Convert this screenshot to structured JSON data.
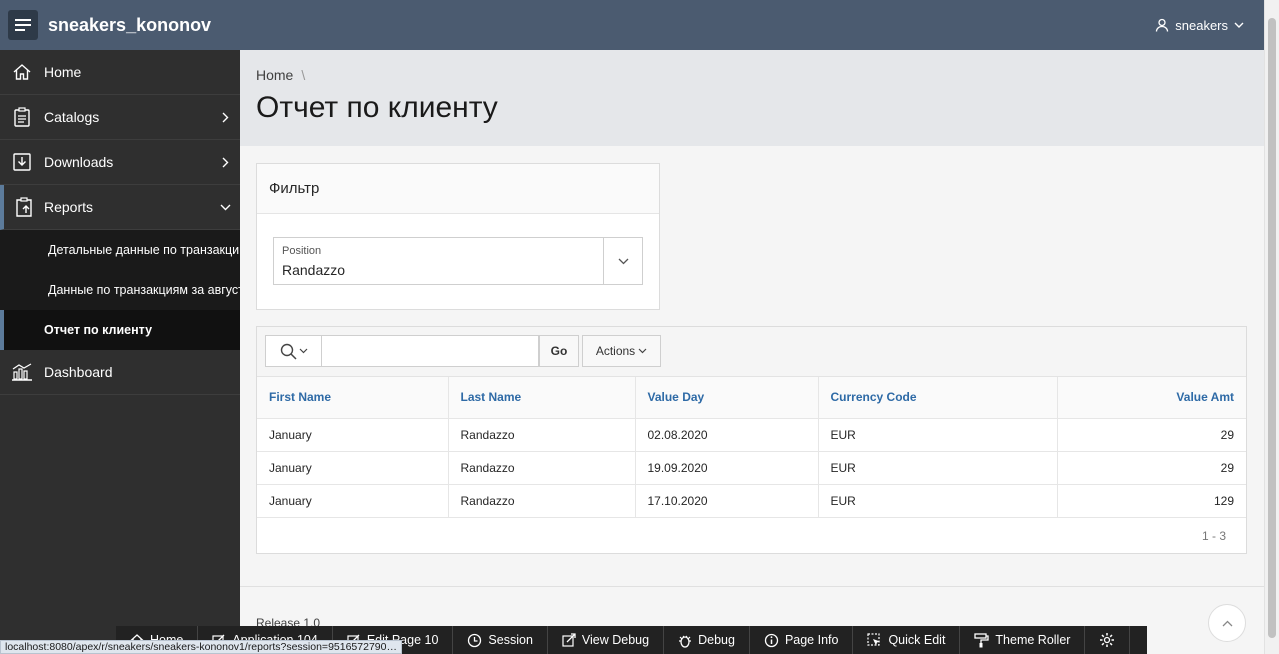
{
  "header": {
    "app_title": "sneakers_kononov",
    "user": "sneakers"
  },
  "sidebar": {
    "items": [
      {
        "label": "Home"
      },
      {
        "label": "Catalogs"
      },
      {
        "label": "Downloads"
      },
      {
        "label": "Reports"
      },
      {
        "label": "Dashboard"
      }
    ],
    "reports_sub": [
      {
        "label": "Детальные данные по транзакци…"
      },
      {
        "label": "Данные по транзакциям за август"
      },
      {
        "label": "Отчет по клиенту"
      }
    ]
  },
  "breadcrumb": {
    "home": "Home",
    "separator": "\\"
  },
  "page": {
    "title": "Отчет по клиенту"
  },
  "filter": {
    "title": "Фильтр",
    "position_label": "Position",
    "position_value": "Randazzo"
  },
  "report": {
    "search_placeholder": "",
    "go_label": "Go",
    "actions_label": "Actions",
    "columns": [
      "First Name",
      "Last Name",
      "Value Day",
      "Currency Code",
      "Value Amt"
    ],
    "rows": [
      [
        "January",
        "Randazzo",
        "02.08.2020",
        "EUR",
        "29"
      ],
      [
        "January",
        "Randazzo",
        "19.09.2020",
        "EUR",
        "29"
      ],
      [
        "January",
        "Randazzo",
        "17.10.2020",
        "EUR",
        "129"
      ]
    ],
    "pagination": "1 - 3"
  },
  "footer": {
    "release": "Release 1.0"
  },
  "devbar": {
    "items": [
      "Home",
      "Application 104",
      "Edit Page 10",
      "Session",
      "View Debug",
      "Debug",
      "Page Info",
      "Quick Edit",
      "Theme Roller"
    ]
  },
  "status_url": "localhost:8080/apex/r/sneakers/sneakers-kononov1/reports?session=9516572790…",
  "colors": {
    "header": "#4b5b70",
    "sidebar": "#2f2f2f",
    "link": "#2e6aa6"
  }
}
